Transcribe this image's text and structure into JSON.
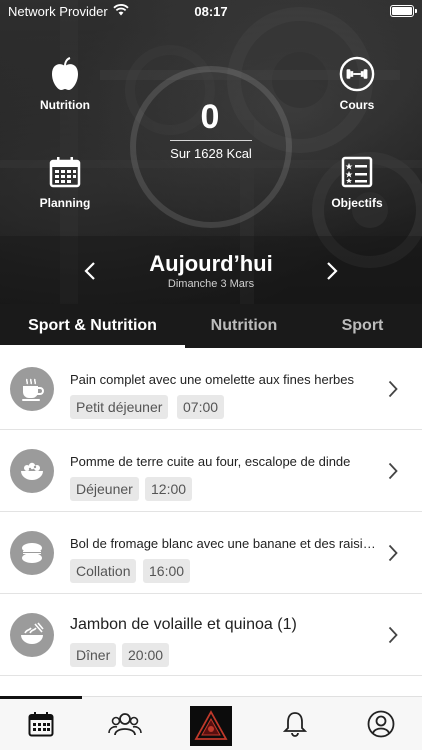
{
  "status_bar": {
    "carrier": "Network Provider",
    "time": "08:17"
  },
  "hero": {
    "quick_actions": [
      {
        "label": "Nutrition",
        "icon": "apple-icon"
      },
      {
        "label": "Cours",
        "icon": "dumbbell-icon"
      },
      {
        "label": "Planning",
        "icon": "calendar-icon"
      },
      {
        "label": "Objectifs",
        "icon": "checklist-icon"
      }
    ],
    "kcal_value": "0",
    "kcal_sub": "Sur 1628 Kcal",
    "date_title": "Aujourd’hui",
    "date_sub": "Dimanche 3 Mars"
  },
  "tabs": [
    {
      "label": "Sport & Nutrition",
      "active": true
    },
    {
      "label": "Nutrition",
      "active": false
    },
    {
      "label": "Sport",
      "active": false
    }
  ],
  "meals": [
    {
      "title": "Pain complet avec une omelette aux fines herbes",
      "meal_type": "Petit déjeuner",
      "time": "07:00",
      "icon": "coffee-cup-icon"
    },
    {
      "title": "Pomme de terre cuite au four, escalope de dinde",
      "meal_type": "Déjeuner",
      "time": "12:00",
      "icon": "salad-bowl-icon"
    },
    {
      "title": "Bol de fromage blanc avec une banane et des raisins",
      "meal_type": "Collation",
      "time": "16:00",
      "icon": "macaron-icon"
    },
    {
      "title": "Jambon de volaille et quinoa (1)",
      "meal_type": "Dîner",
      "time": "20:00",
      "icon": "noodle-bowl-icon"
    }
  ],
  "bottom_nav": [
    {
      "icon": "calendar-icon",
      "active": true
    },
    {
      "icon": "group-icon",
      "active": false
    },
    {
      "icon": "logo-icon",
      "active": false
    },
    {
      "icon": "bell-icon",
      "active": false
    },
    {
      "icon": "profile-icon",
      "active": false
    }
  ],
  "colors": {
    "tab_bar_bg": "#1a1a1a",
    "chip_bg": "#e8e8e8",
    "meal_icon_bg": "#9b9b9b",
    "logo_bg": "#0c0c0c",
    "logo_accent": "#c0392b"
  }
}
